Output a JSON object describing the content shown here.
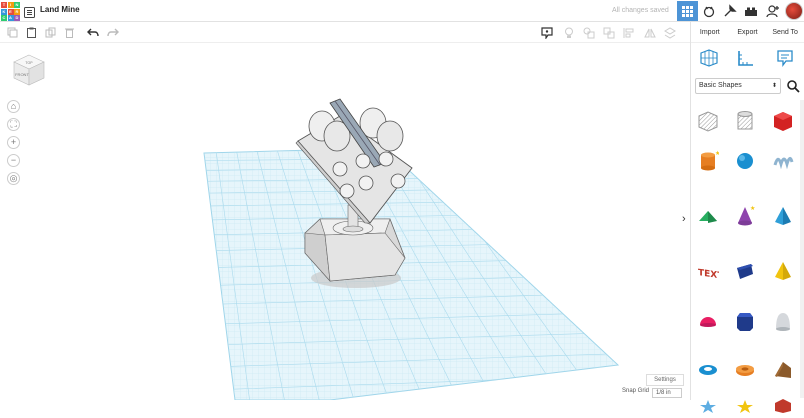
{
  "app": {
    "logo_letters": [
      "T",
      "I",
      "N",
      "K",
      "E",
      "R",
      "C",
      "A",
      "D"
    ],
    "logo_colors": [
      "#e74c3c",
      "#f39c12",
      "#2ecc71",
      "#3498db",
      "#e74c3c",
      "#f39c12",
      "#2ecc71",
      "#3498db",
      "#9b59b6"
    ],
    "project_title": "Land Mine",
    "save_status": "All changes saved"
  },
  "top_icons": [
    "grid-view-icon",
    "tinker-icon",
    "build-icon",
    "lego-brick-icon",
    "add-user-icon",
    "avatar-icon"
  ],
  "toolbar": {
    "left_icons": [
      "copy-icon",
      "paste-icon",
      "duplicate-icon",
      "delete-icon",
      "undo-icon",
      "redo-icon"
    ],
    "right_icons": [
      "notes-icon",
      "light-icon",
      "shape-icon",
      "group-icon",
      "align-icon",
      "mirror-icon",
      "workplane-icon"
    ]
  },
  "panel": {
    "actions": {
      "import": "Import",
      "export": "Export",
      "send_to": "Send To"
    },
    "tool_icons": [
      "workplane-grid-icon",
      "ruler-icon",
      "notes-bubble-icon"
    ],
    "library": "Basic Shapes",
    "shapes": [
      "box-hole",
      "cylinder-hole",
      "box",
      "cylinder",
      "sphere",
      "scribble",
      "roof",
      "cone",
      "pyramid",
      "text",
      "prism",
      "cone-yellow",
      "half-sphere",
      "polygon",
      "paraboloid",
      "torus",
      "tube",
      "wedge",
      "star",
      "star-yellow",
      "icosahedron"
    ]
  },
  "canvas": {
    "viewcube_top": "TOP",
    "viewcube_front": "FRONT",
    "left_tools": [
      "home-view-icon",
      "fit-view-icon",
      "zoom-in-icon",
      "zoom-out-icon",
      "perspective-icon"
    ],
    "settings_label": "Settings",
    "snap_grid_label": "Snap Grid",
    "snap_grid_value": "1/8 in"
  }
}
